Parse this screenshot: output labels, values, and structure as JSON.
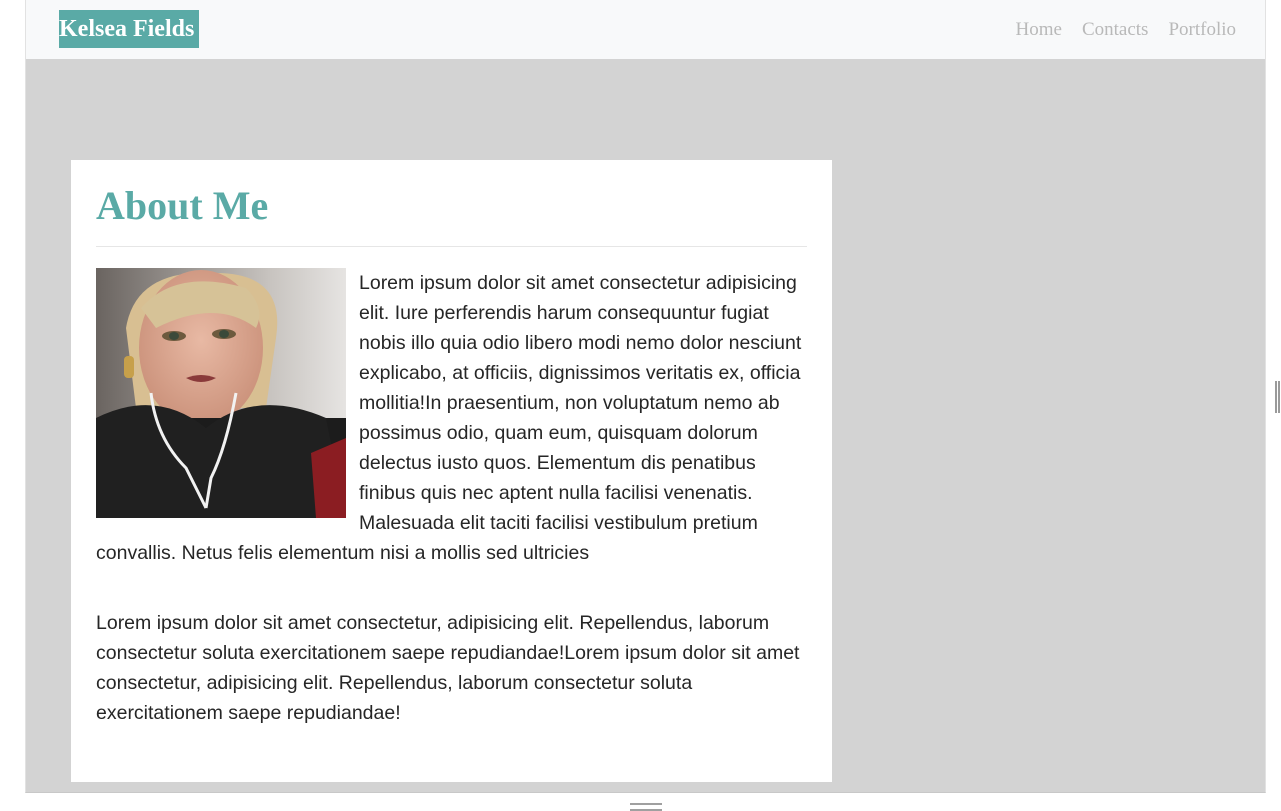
{
  "navbar": {
    "brand": "Kelsea Fields",
    "links": [
      "Home",
      "Contacts",
      "Portfolio"
    ]
  },
  "about": {
    "title": "About Me",
    "paragraph_1": "Lorem ipsum dolor sit amet consectetur adipisicing elit. Iure perferendis harum consequuntur fugiat nobis illo quia odio libero modi nemo dolor nesciunt explicabo, at officiis, dignissimos veritatis ex, officia mollitia!In praesentium, non voluptatum nemo ab possimus odio, quam eum, quisquam dolorum delectus iusto quos. Elementum dis penatibus finibus quis nec aptent nulla facilisi venenatis. Malesuada elit taciti facilisi vestibulum pretium convallis. Netus felis elementum nisi a mollis sed ultricies",
    "paragraph_2": "Lorem ipsum dolor sit amet consectetur, adipisicing elit. Repellendus, laborum consectetur soluta exercitationem saepe repudiandae!Lorem ipsum dolor sit amet consectetur, adipisicing elit. Repellendus, laborum consectetur soluta exercitationem saepe repudiandae!"
  },
  "colors": {
    "accent": "#5aaaa6",
    "page_background": "#d3d3d3",
    "navbar_background": "#f8f9fa",
    "nav_link": "#b9b9b9"
  }
}
